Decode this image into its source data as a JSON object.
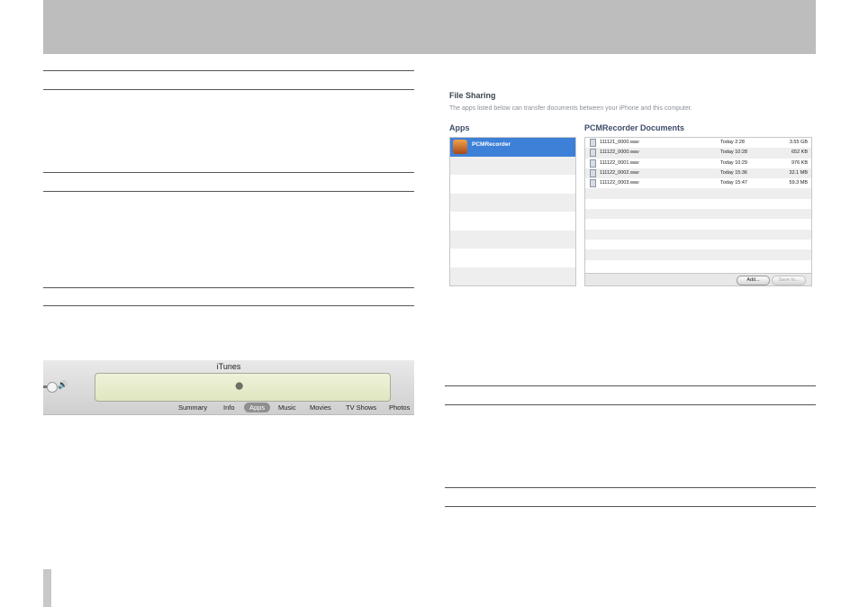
{
  "itunes": {
    "title": "iTunes",
    "tabs": [
      {
        "label": "Summary",
        "active": false
      },
      {
        "label": "Info",
        "active": false
      },
      {
        "label": "Apps",
        "active": true
      },
      {
        "label": "Music",
        "active": false
      },
      {
        "label": "Movies",
        "active": false
      },
      {
        "label": "TV Shows",
        "active": false
      },
      {
        "label": "Photos",
        "active": false
      }
    ],
    "lcd_icon": "apple-logo-icon",
    "volume_icon": "speaker-icon"
  },
  "file_sharing": {
    "title": "File Sharing",
    "description": "The apps listed below can transfer documents between your iPhone and this computer.",
    "apps_heading": "Apps",
    "apps": [
      {
        "name": "PCMRecorder",
        "selected": true,
        "icon": "pcmrecorder-app-icon"
      }
    ],
    "documents_heading": "PCMRecorder Documents",
    "documents": [
      {
        "name": "111121_0000.wav",
        "date": "Today 2:28",
        "size": "3.55 GB"
      },
      {
        "name": "111122_0000.wav",
        "date": "Today 10:28",
        "size": "652 KB"
      },
      {
        "name": "111122_0001.wav",
        "date": "Today 10:29",
        "size": "976 KB"
      },
      {
        "name": "111122_0002.wav",
        "date": "Today 15:36",
        "size": "32.1 MB"
      },
      {
        "name": "111122_0003.wav",
        "date": "Today 15:47",
        "size": "59.3 MB"
      }
    ],
    "add_button": "Add...",
    "save_button": "Save to...",
    "selection_color": "#3d80d8"
  }
}
